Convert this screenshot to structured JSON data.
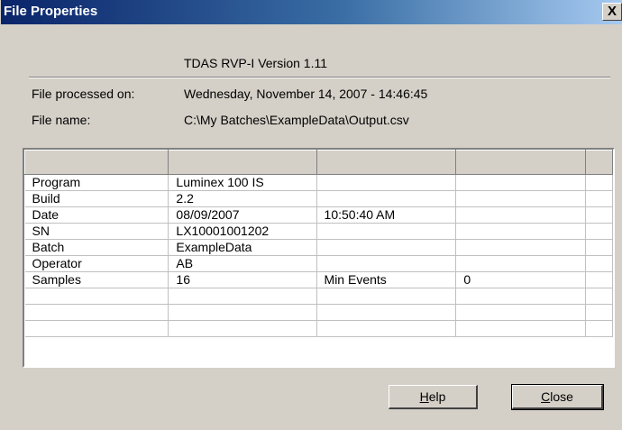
{
  "window": {
    "title": "File Properties",
    "close_glyph": "X"
  },
  "header": {
    "version": "TDAS RVP-I Version 1.11"
  },
  "info": {
    "processed_label": "File processed on:",
    "processed_value": "Wednesday, November 14, 2007 - 14:46:45",
    "filename_label": "File name:",
    "filename_value": "C:\\My Batches\\ExampleData\\Output.csv"
  },
  "grid": {
    "rows": [
      [
        "Program",
        "Luminex 100 IS",
        "",
        ""
      ],
      [
        "Build",
        "2.2",
        "",
        ""
      ],
      [
        "Date",
        "08/09/2007",
        "10:50:40 AM",
        ""
      ],
      [
        "SN",
        "LX10001001202",
        "",
        ""
      ],
      [
        "Batch",
        "ExampleData",
        "",
        ""
      ],
      [
        "Operator",
        "AB",
        "",
        ""
      ],
      [
        "Samples",
        "16",
        "Min Events",
        "0"
      ],
      [
        "",
        "",
        "",
        ""
      ],
      [
        "",
        "",
        "",
        ""
      ],
      [
        "",
        "",
        "",
        ""
      ]
    ]
  },
  "buttons": {
    "help_mnemonic": "H",
    "help_rest": "elp",
    "close_mnemonic": "C",
    "close_rest": "lose"
  }
}
